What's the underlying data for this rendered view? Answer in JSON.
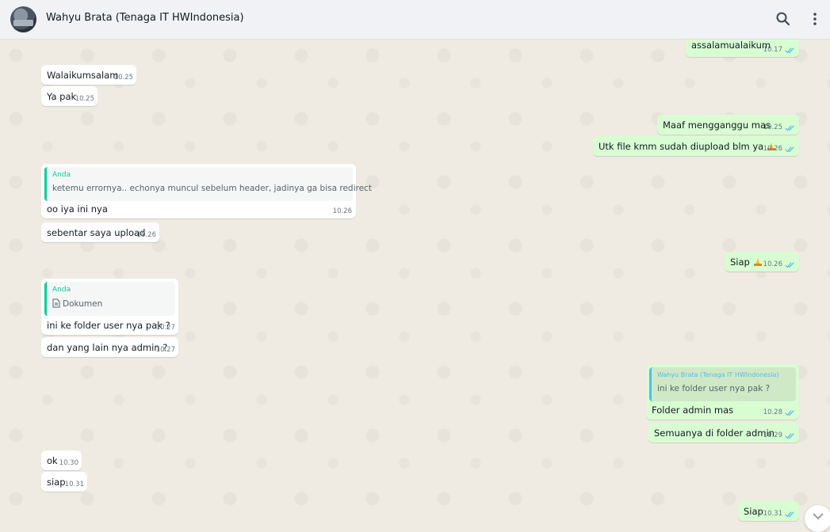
{
  "header": {
    "contact_name": "Wahyu Brata (Tenaga IT HWIndonesia)",
    "icons": [
      "search-icon",
      "menu-icon"
    ]
  },
  "messages": [
    {
      "dir": "out",
      "text": "assalamualaikum",
      "time": "10.17",
      "status": "read"
    },
    {
      "dir": "in",
      "text": "Walaikumsalam",
      "time": "10.25"
    },
    {
      "dir": "in",
      "text": "Ya pak",
      "time": "10.25"
    },
    {
      "dir": "out",
      "text": "Maaf mengganggu mas",
      "time": "10.25",
      "status": "read"
    },
    {
      "dir": "out",
      "text": "Utk file kmm sudah diupload blm ya",
      "emoji": "folded-hands",
      "time": "10.26",
      "status": "read"
    },
    {
      "dir": "in",
      "quote_author": "Anda",
      "quote_text": "ketemu errornya.. echonya muncul sebelum header, jadinya ga bisa redirect",
      "text": "oo iya ini nya",
      "time": "10.26"
    },
    {
      "dir": "in",
      "text": "sebentar saya upload",
      "time": "10.26"
    },
    {
      "dir": "out",
      "text": "Siap",
      "emoji": "folded-hands",
      "time": "10.26",
      "status": "read"
    },
    {
      "dir": "in",
      "quote_author": "Anda",
      "quote_text": "Dokumen",
      "quote_icon": "document-icon",
      "text": "ini ke folder user nya pak ?",
      "time": "10.27"
    },
    {
      "dir": "in",
      "text": "dan yang lain nya admin ?",
      "time": "10.27"
    },
    {
      "dir": "out",
      "quote_author": "Wahyu Brata (Tenaga IT HWIndonesia)",
      "quote_text": "ini ke folder user nya pak ?",
      "text": "Folder admin mas",
      "time": "10.28",
      "status": "read"
    },
    {
      "dir": "out",
      "text": "Semuanya di folder admin",
      "time": "10.29",
      "status": "read"
    },
    {
      "dir": "in",
      "text": "ok",
      "time": "10.30"
    },
    {
      "dir": "in",
      "text": "siap",
      "time": "10.31"
    },
    {
      "dir": "out",
      "text": "Siap",
      "time": "10.31",
      "status": "read"
    }
  ],
  "colors": {
    "incoming_bubble": "#ffffff",
    "outgoing_bubble": "#d9fdd3",
    "read_ticks": "#53bdeb",
    "quote_self": "#06cf9c",
    "quote_other": "#53bdeb"
  }
}
